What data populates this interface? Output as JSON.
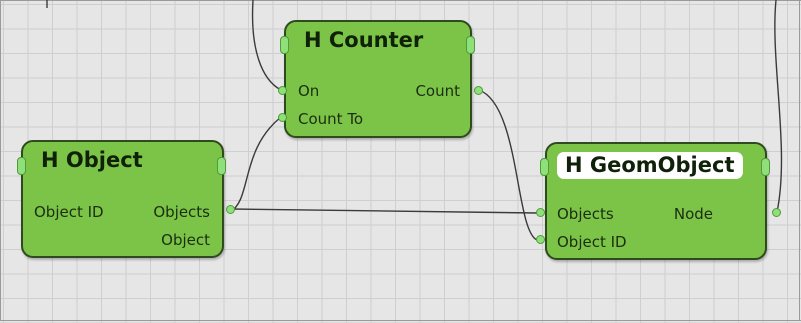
{
  "nodes": {
    "counter": {
      "title": "H Counter",
      "inputs": [
        "On",
        "Count To"
      ],
      "outputs": [
        "Count"
      ]
    },
    "object": {
      "title": "H Object",
      "inputs": [
        "Object ID"
      ],
      "outputs": [
        "Objects",
        "Object"
      ]
    },
    "geom_object": {
      "title": "H GeomObject",
      "inputs": [
        "Objects",
        "Object ID"
      ],
      "outputs": [
        "Node"
      ]
    }
  },
  "connections": [
    {
      "from": "object.Objects",
      "to": "counter.Count To"
    },
    {
      "from": "object.Objects",
      "to": "geom_object.Objects"
    },
    {
      "from": "counter.Count",
      "to": "geom_object.Object ID"
    }
  ],
  "colors": {
    "node_fill": "#7cc447",
    "node_border": "#2f4a1e",
    "port_fill": "#8fe07a",
    "wire": "#3a3a3a",
    "grid": "#cfcfcf",
    "background": "#e6e6e6"
  }
}
